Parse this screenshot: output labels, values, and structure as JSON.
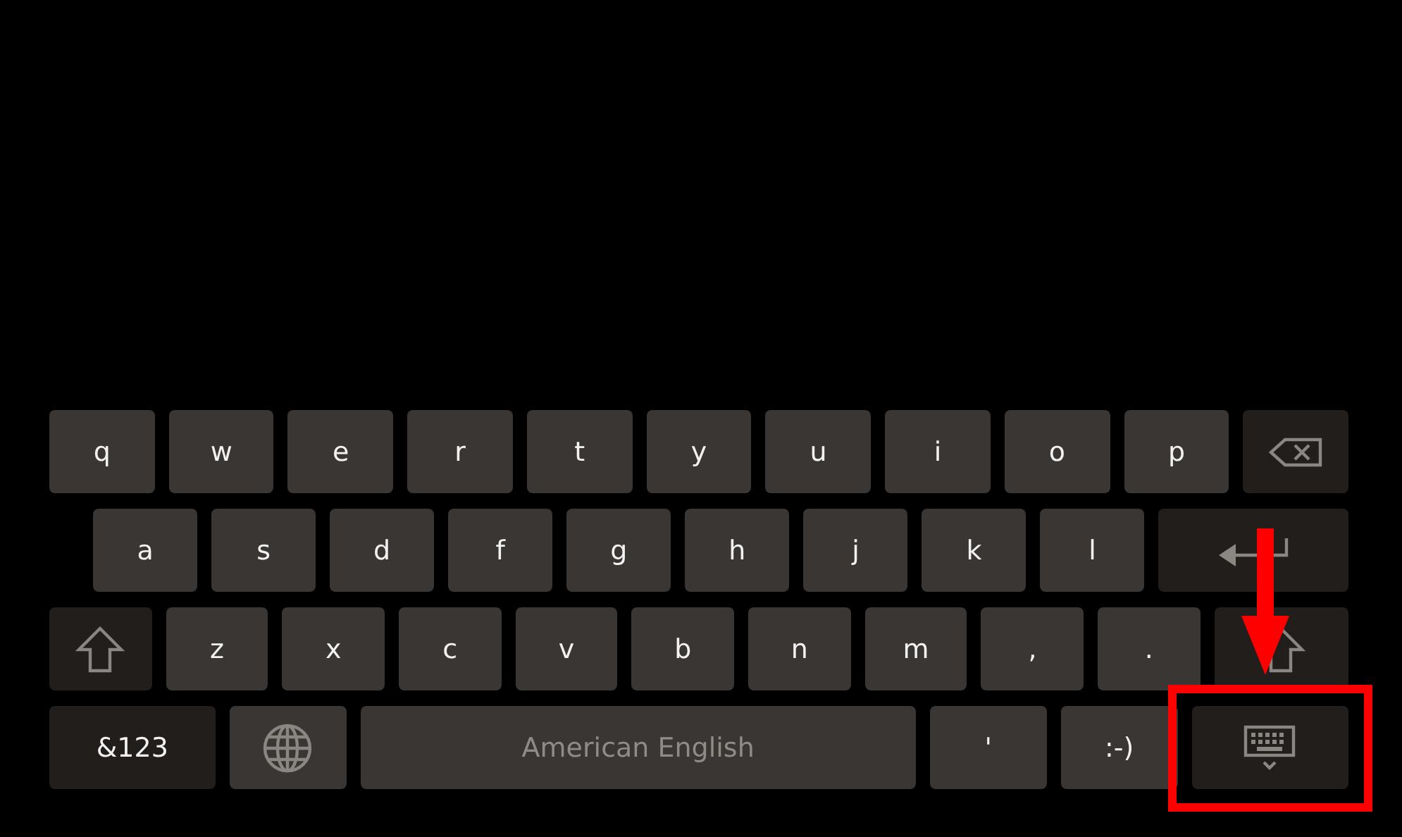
{
  "keyboard": {
    "rows": [
      {
        "keys": [
          {
            "kind": "letter",
            "label": "q"
          },
          {
            "kind": "letter",
            "label": "w"
          },
          {
            "kind": "letter",
            "label": "e"
          },
          {
            "kind": "letter",
            "label": "r"
          },
          {
            "kind": "letter",
            "label": "t"
          },
          {
            "kind": "letter",
            "label": "y"
          },
          {
            "kind": "letter",
            "label": "u"
          },
          {
            "kind": "letter",
            "label": "i"
          },
          {
            "kind": "letter",
            "label": "o"
          },
          {
            "kind": "letter",
            "label": "p"
          },
          {
            "kind": "backspace"
          }
        ]
      },
      {
        "keys": [
          {
            "kind": "letter",
            "label": "a"
          },
          {
            "kind": "letter",
            "label": "s"
          },
          {
            "kind": "letter",
            "label": "d"
          },
          {
            "kind": "letter",
            "label": "f"
          },
          {
            "kind": "letter",
            "label": "g"
          },
          {
            "kind": "letter",
            "label": "h"
          },
          {
            "kind": "letter",
            "label": "j"
          },
          {
            "kind": "letter",
            "label": "k"
          },
          {
            "kind": "letter",
            "label": "l"
          },
          {
            "kind": "enter"
          }
        ]
      },
      {
        "keys": [
          {
            "kind": "shift"
          },
          {
            "kind": "letter",
            "label": "z"
          },
          {
            "kind": "letter",
            "label": "x"
          },
          {
            "kind": "letter",
            "label": "c"
          },
          {
            "kind": "letter",
            "label": "v"
          },
          {
            "kind": "letter",
            "label": "b"
          },
          {
            "kind": "letter",
            "label": "n"
          },
          {
            "kind": "letter",
            "label": "m"
          },
          {
            "kind": "letter",
            "label": ","
          },
          {
            "kind": "letter",
            "label": "."
          },
          {
            "kind": "shift"
          }
        ]
      },
      {
        "keys": [
          {
            "kind": "symbols",
            "label": "&123"
          },
          {
            "kind": "globe"
          },
          {
            "kind": "space",
            "label": "American English"
          },
          {
            "kind": "letter",
            "label": "'"
          },
          {
            "kind": "letter",
            "label": ":-)"
          },
          {
            "kind": "hide"
          }
        ]
      }
    ]
  }
}
